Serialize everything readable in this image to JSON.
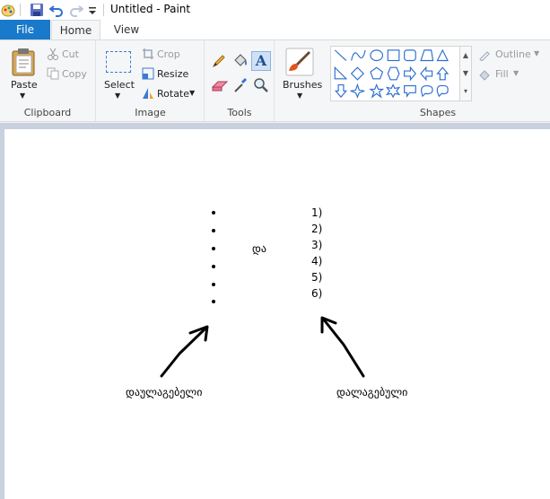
{
  "window": {
    "title": "Untitled - Paint"
  },
  "quick_access": [
    "paint-app-icon",
    "save-icon",
    "undo-icon",
    "redo-icon",
    "customize-qat-icon"
  ],
  "tabs": {
    "file": "File",
    "home": "Home",
    "view": "View"
  },
  "ribbon": {
    "clipboard": {
      "paste": "Paste",
      "cut": "Cut",
      "copy": "Copy",
      "label": "Clipboard"
    },
    "image": {
      "select": "Select",
      "crop": "Crop",
      "resize": "Resize",
      "rotate": "Rotate",
      "label": "Image"
    },
    "tools": {
      "label": "Tools"
    },
    "brushes": {
      "label": "Brushes"
    },
    "shapes": {
      "outline": "Outline",
      "fill": "Fill",
      "label": "Shapes"
    }
  },
  "canvas": {
    "middle_word": "და",
    "numbered_list": [
      "1)",
      "2)",
      "3)",
      "4)",
      "5)",
      "6)"
    ],
    "left_caption": "დაულაგებელი",
    "right_caption": "დალაგებული"
  },
  "colors": {
    "file_tab": "#1979ca",
    "workspace": "#c8d1dd",
    "canvas": "#ffffff",
    "icon_blue": "#3a7bd5"
  }
}
